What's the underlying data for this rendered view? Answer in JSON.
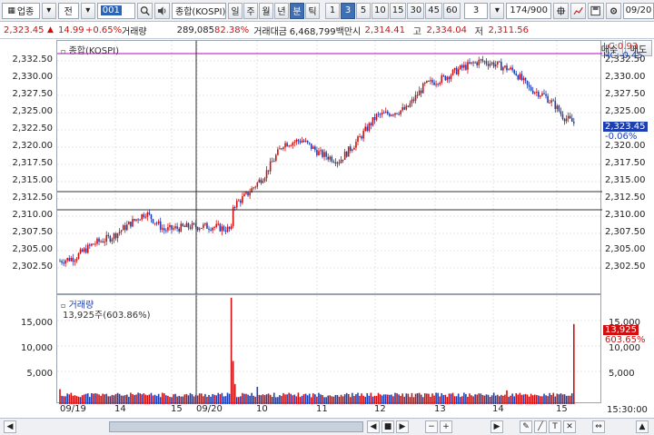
{
  "toolbar": {
    "category": "업종",
    "market": "전",
    "code": "001",
    "name": "종합(KOSPI)",
    "periods": [
      "일",
      "주",
      "월",
      "년",
      "분",
      "틱"
    ],
    "active_period": "분",
    "intervals": [
      "1",
      "3",
      "5",
      "10",
      "15",
      "30",
      "45",
      "60"
    ],
    "active_interval": "3",
    "interval_select": "3",
    "count": "174/900",
    "date": "09/20"
  },
  "infobar": {
    "price": "2,323.45",
    "change": "14.99",
    "change_pct": "+0.65%",
    "vol_label": "거래량",
    "volume": "289,085",
    "vol_ratio": "82.38%",
    "amt_label": "거래대금",
    "amount": "6,468,799백만",
    "open_label": "시",
    "open": "2,314.41",
    "high_label": "고",
    "high": "2,334.04",
    "low_label": "저",
    "low": "2,311.56",
    "buy": "매수",
    "sell": "매도"
  },
  "price_pane": {
    "title": "종합(KOSPI)",
    "lc": "LC:0.93",
    "hc": "HC:-0.45",
    "current_tag": "2,323.45",
    "pct_tag": "-0.06%",
    "y_ticks": [
      "2,332.50",
      "2,330.00",
      "2,327.50",
      "2,325.00",
      "2,322.50",
      "2,320.00",
      "2,317.50",
      "2,315.00",
      "2,312.50",
      "2,310.00",
      "2,307.50",
      "2,305.00",
      "2,302.50"
    ]
  },
  "vol_pane": {
    "title": "거래량",
    "subtitle": "13,925주(603.86%)",
    "y_ticks": [
      "15,000",
      "10,000",
      "5,000"
    ],
    "cur_tag": "13,925",
    "pct_tag": "603.65%"
  },
  "x_axis": [
    "09/19",
    "14",
    "15",
    "09/20",
    "10",
    "11",
    "12",
    "13",
    "14",
    "15"
  ],
  "time": "15:30:00",
  "colors": {
    "up": "#d01010",
    "down": "#1d3fb0",
    "crosshair": "#c000c0"
  }
}
